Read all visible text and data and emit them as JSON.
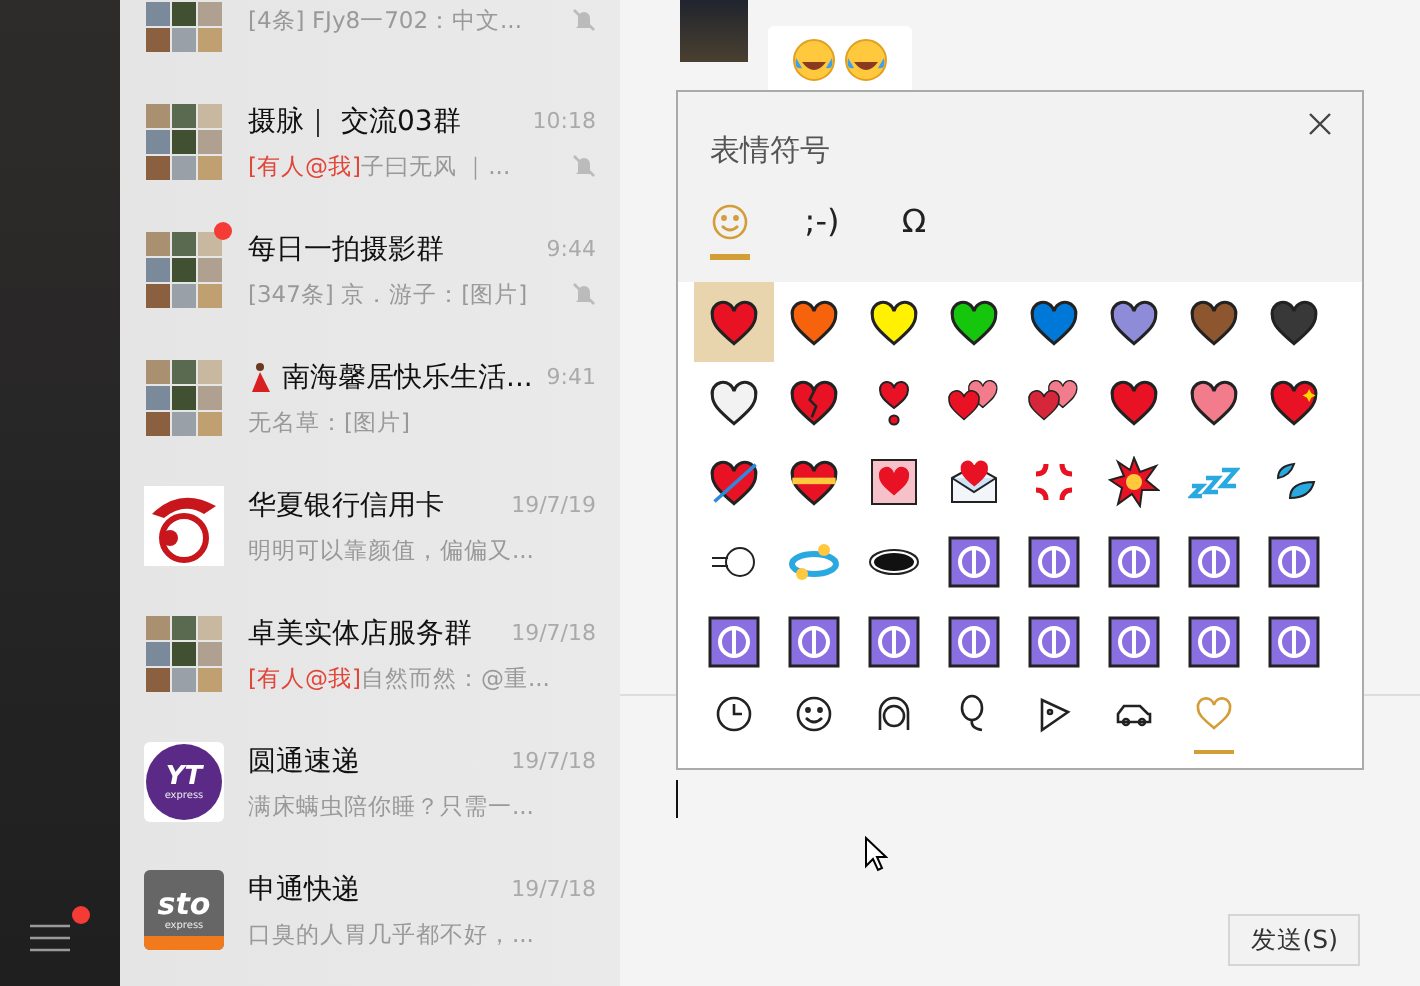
{
  "chats": [
    {
      "preview": "[4条] FJy8一702：中文...",
      "muted": true,
      "unread": false,
      "avatar": {
        "kind": "collage"
      }
    },
    {
      "name": "摄脉｜ 交流03群",
      "time": "10:18",
      "mention": "[有人@我]",
      "preview": "子曰无风 ｜...",
      "muted": true,
      "unread": false,
      "avatar": {
        "kind": "collage"
      }
    },
    {
      "name": "每日一拍摄影群",
      "time": "9:44",
      "preview": "[347条] 京．游子：[图片]",
      "muted": true,
      "unread": true,
      "avatar": {
        "kind": "collage"
      }
    },
    {
      "name": "南海馨居快乐生活...",
      "time": "9:41",
      "preview": "无名草：[图片]",
      "muted": false,
      "unread": false,
      "dancer": true,
      "avatar": {
        "kind": "collage"
      }
    },
    {
      "name": "华夏银行信用卡",
      "time": "19/7/19",
      "preview": "明明可以靠颜值，偏偏又...",
      "muted": false,
      "unread": false,
      "avatar": {
        "kind": "mascot"
      }
    },
    {
      "name": "卓美实体店服务群",
      "time": "19/7/18",
      "mention": "[有人@我]",
      "preview": "自然而然：@重...",
      "muted": false,
      "unread": false,
      "avatar": {
        "kind": "collage"
      }
    },
    {
      "name": "圆通速递",
      "time": "19/7/18",
      "preview": "满床螨虫陪你睡？只需一...",
      "muted": false,
      "unread": false,
      "avatar": {
        "kind": "yto",
        "text": "YT",
        "subtext": "express"
      }
    },
    {
      "name": "申通快递",
      "time": "19/7/18",
      "preview": "口臭的人胃几乎都不好，...",
      "muted": false,
      "unread": false,
      "avatar": {
        "kind": "sto",
        "text": "sto",
        "subtext": "express"
      }
    }
  ],
  "menu": {
    "unread": true
  },
  "emoji_panel": {
    "title": "表情符号",
    "tabs": [
      {
        "kind": "smiley",
        "selected": true
      },
      {
        "kind": "text",
        "label": ";-)",
        "selected": false
      },
      {
        "kind": "text",
        "label": "Ω",
        "selected": false
      }
    ],
    "grid": [
      {
        "kind": "heart",
        "color": "#e81224",
        "selected": true
      },
      {
        "kind": "heart",
        "color": "#f7630c",
        "selected": false
      },
      {
        "kind": "heart",
        "color": "#fff100",
        "selected": false
      },
      {
        "kind": "heart",
        "color": "#16c60c",
        "selected": false
      },
      {
        "kind": "heart",
        "color": "#0078d7",
        "selected": false
      },
      {
        "kind": "heart",
        "color": "#8e8cd8",
        "selected": false
      },
      {
        "kind": "heart",
        "color": "#8e562e",
        "selected": false
      },
      {
        "kind": "heart",
        "color": "#383838",
        "selected": false
      },
      {
        "kind": "heart",
        "color": "#f2f2f2",
        "selected": false
      },
      {
        "kind": "broken",
        "color": "#e81224",
        "selected": false
      },
      {
        "kind": "exclaim",
        "color": "#e81224",
        "selected": false
      },
      {
        "kind": "pair",
        "color": "#e81224",
        "selected": false
      },
      {
        "kind": "pair",
        "color": "#d6273a",
        "selected": false
      },
      {
        "kind": "heart",
        "color": "#e81224",
        "selected": false
      },
      {
        "kind": "heart",
        "color": "#f27c8c",
        "selected": false
      },
      {
        "kind": "sparkle",
        "color": "#e81224",
        "selected": false
      },
      {
        "kind": "arrow",
        "color": "#e81224",
        "selected": false
      },
      {
        "kind": "ribbon",
        "color": "#e81224",
        "selected": false
      },
      {
        "kind": "framed",
        "color": "#e81224",
        "selected": false
      },
      {
        "kind": "letter",
        "color": "#e81224",
        "selected": false
      },
      {
        "kind": "anger",
        "color": "#e81224",
        "selected": false
      },
      {
        "kind": "burst",
        "color": "#e81224",
        "selected": false
      },
      {
        "kind": "zzz",
        "color": "#2aa8e0",
        "selected": false
      },
      {
        "kind": "drops",
        "color": "#2aa8e0",
        "selected": false
      },
      {
        "kind": "dash",
        "selected": false
      },
      {
        "kind": "dizzy",
        "color": "#2aa8e0",
        "selected": false
      },
      {
        "kind": "hole",
        "color": "#111111",
        "selected": false
      },
      {
        "kind": "tile",
        "color": "#8a6fe0",
        "selected": false
      },
      {
        "kind": "tile",
        "color": "#8a6fe0",
        "selected": false
      },
      {
        "kind": "tile",
        "color": "#8a6fe0",
        "selected": false
      },
      {
        "kind": "tile",
        "color": "#8a6fe0",
        "selected": false
      },
      {
        "kind": "tile",
        "color": "#8a6fe0",
        "selected": false
      },
      {
        "kind": "tile",
        "color": "#8a6fe0",
        "selected": false
      },
      {
        "kind": "tile",
        "color": "#8a6fe0",
        "selected": false
      },
      {
        "kind": "tile",
        "color": "#8a6fe0",
        "selected": false
      },
      {
        "kind": "tile",
        "color": "#8a6fe0",
        "selected": false
      },
      {
        "kind": "tile",
        "color": "#8a6fe0",
        "selected": false
      },
      {
        "kind": "tile",
        "color": "#8a6fe0",
        "selected": false
      },
      {
        "kind": "tile",
        "color": "#8a6fe0",
        "selected": false
      },
      {
        "kind": "tile",
        "color": "#8a6fe0",
        "selected": false
      }
    ],
    "categories": [
      {
        "kind": "clock",
        "selected": false
      },
      {
        "kind": "smiley",
        "selected": false
      },
      {
        "kind": "face",
        "selected": false
      },
      {
        "kind": "balloon",
        "selected": false
      },
      {
        "kind": "pizza",
        "selected": false
      },
      {
        "kind": "car",
        "selected": false
      },
      {
        "kind": "heart",
        "selected": true
      }
    ]
  },
  "send_button": "发送(S)"
}
